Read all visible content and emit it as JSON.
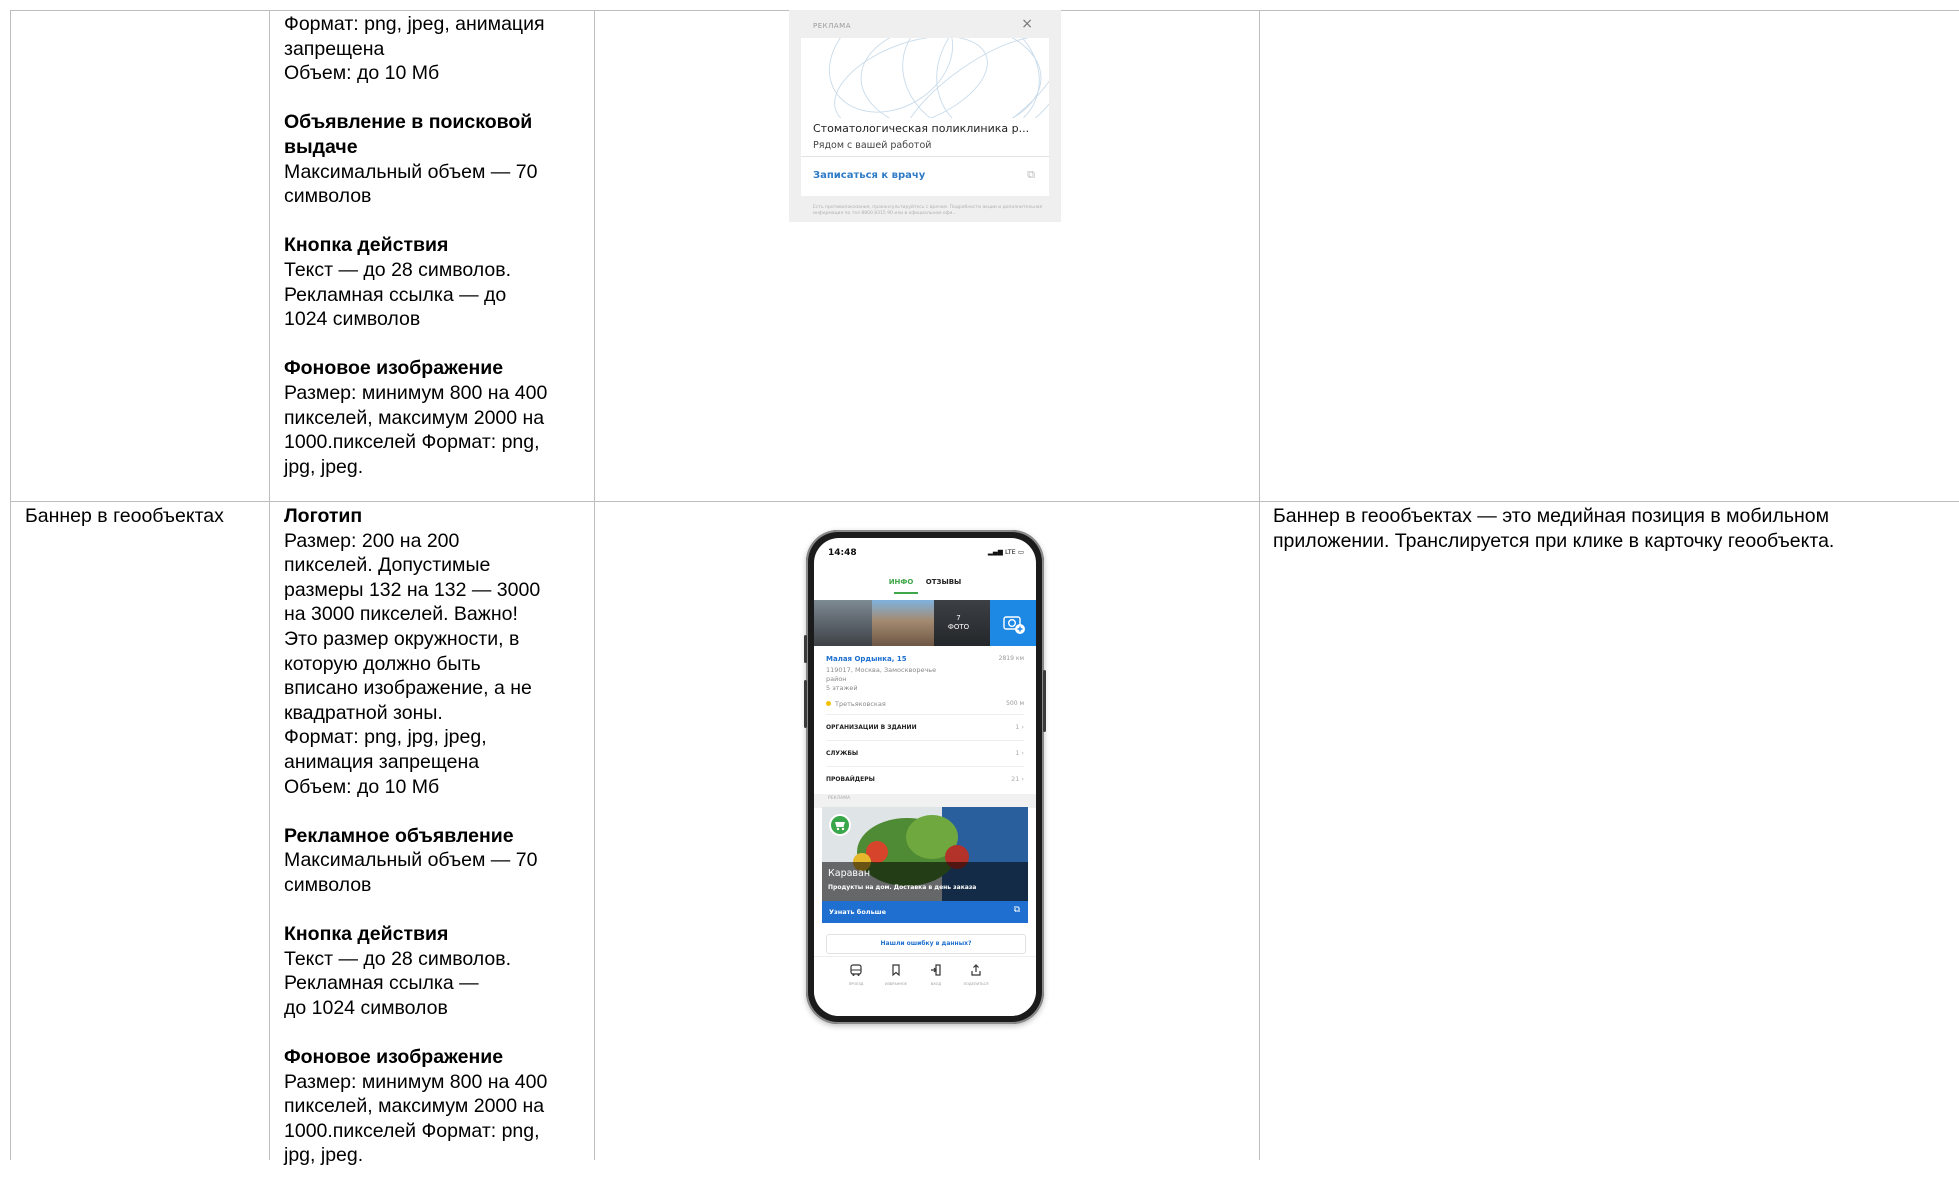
{
  "row1": {
    "col2_lines": {
      "format": "Формат: png, jpeg, анимация\nзапрещена",
      "volume": "Объем: до 10 Мб"
    },
    "search_ad": {
      "heading": "Объявление в поисковой\nвыдаче",
      "text": "Максимальный объем — 70\nсимволов"
    },
    "action_button": {
      "heading": "Кнопка действия",
      "text": "Текст — до 28 символов.\nРекламная ссылка — до\n1024 символов"
    },
    "background_image": {
      "heading": "Фоновое изображение",
      "text": "Размер: минимум 800 на 400\nпикселей, максимум 2000 на\n1000.пикселей Формат: png,\njpg, jpeg."
    },
    "ad_preview": {
      "label": "РЕКЛАМА",
      "close": "×",
      "title": "Стоматологическая поликлиника р...",
      "subtitle": "Рядом с вашей работой",
      "cta": "Записаться к врачу",
      "ext_icon": "external-link-icon",
      "disclaimer": "Есть противопоказания, проконсультируйтесь с врачом. Подробности акции и дополнительная информация по тел 8800 8315 90 или в официальном офи..."
    }
  },
  "row2": {
    "name": "Баннер в геообъектах",
    "logo": {
      "heading": "Логотип",
      "text": "Размер: 200 на 200\nпикселей. Допустимые\nразмеры 132 на 132 — 3000\nна 3000 пикселей. Важно!\nЭто размер окружности, в\nкоторую должно быть\nвписано изображение, а не\nквадратной зоны.\nФормат: png, jpg, jpeg,\nанимация запрещена\nОбъем: до 10 Мб"
    },
    "ad_text": {
      "heading": "Рекламное объявление",
      "text": "Максимальный объем — 70\nсимволов"
    },
    "action_button": {
      "heading": "Кнопка действия",
      "text": "Текст — до 28 символов.\nРекламная ссылка —\nдо 1024 символов"
    },
    "background_image": {
      "heading": "Фоновое изображение",
      "text": "Размер: минимум 800 на 400\nпикселей, максимум 2000 на\n1000.пикселей Формат: png,\njpg, jpeg."
    },
    "description": "Баннер в геообъектах — это медийная позиция в мобильном\nприложении. Транслируется при клике в карточку геообъекта.",
    "phone": {
      "time": "14:48",
      "signal": "LTE",
      "tab_info": "ИНФО",
      "tab_reviews": "ОТЗЫВЫ",
      "photo_count": "7\nФОТО",
      "address": "Малая Ордынка, 15",
      "distance": "2819 км",
      "address_details": "119017, Москва, Замоскворечье\nрайон\n5 этажей",
      "metro": "Третьяковская",
      "metro_distance": "500 м",
      "rows": [
        {
          "label": "ОРГАНИЗАЦИИ В ЗДАНИИ",
          "value": "1  ›"
        },
        {
          "label": "СЛУЖБЫ",
          "value": "1  ›"
        },
        {
          "label": "ПРОВАЙДЕРЫ",
          "value": "21  ›"
        }
      ],
      "ad_label": "РЕКЛАМА",
      "banner_name": "Караван",
      "banner_sub": "Продукты на дом. Доставка в день заказа",
      "banner_cta": "Узнать больше",
      "error_link": "Нашли ошибку в данных?",
      "nav": [
        {
          "icon": "🚌",
          "label": "ПРОЕЗД"
        },
        {
          "icon": "🔖",
          "label": "ИЗБРАННОЕ"
        },
        {
          "icon": "⇶",
          "label": "ВХОД"
        },
        {
          "icon": "⇪",
          "label": "ПОДЕЛИТЬСЯ"
        }
      ]
    }
  },
  "colors": {
    "grid": "#bdbdbd",
    "accent_green": "#3fa64a",
    "accent_blue": "#1e6fd0"
  }
}
